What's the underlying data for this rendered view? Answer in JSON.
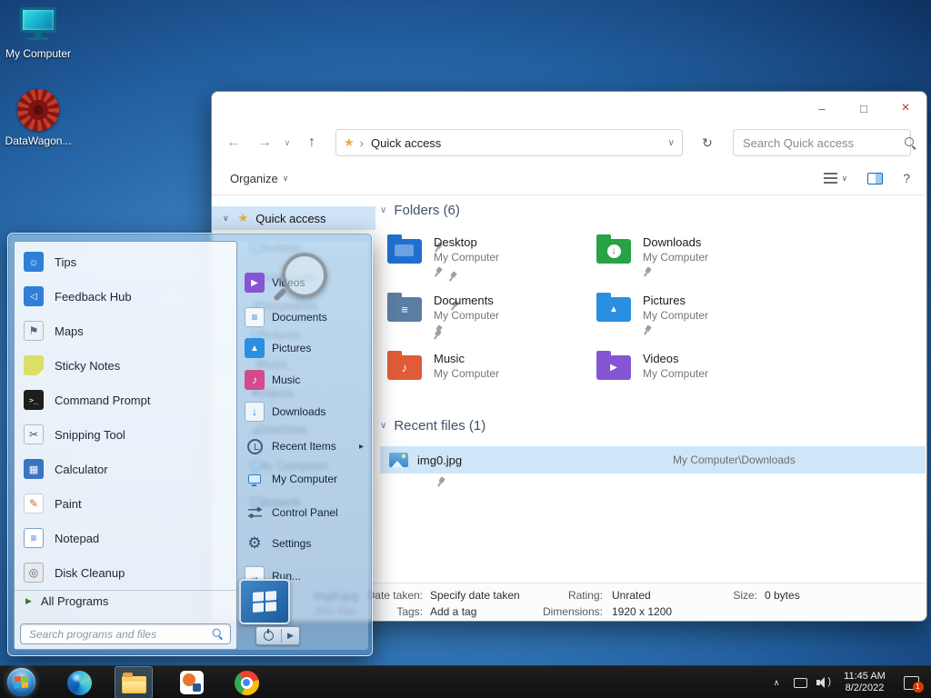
{
  "icons": {
    "minimize": "–",
    "maximize": "□",
    "close": "×",
    "back": "←",
    "forward": "→",
    "up": "↑",
    "refresh": "↻",
    "chevron_down": "∨",
    "chevron_up": "∧",
    "breadcrumb_sep": "›",
    "star": "★",
    "expand_chevron": "›",
    "submenu_arrow": "▸",
    "all_programs_arrow": "▶",
    "help": "?"
  },
  "desktop": {
    "icons": [
      {
        "label": "My Computer"
      },
      {
        "label": "DataWagon..."
      }
    ]
  },
  "explorer": {
    "address_crumb": "Quick access",
    "search_placeholder": "Search Quick access",
    "organize_label": "Organize",
    "sidebar": {
      "quick_access_label": "Quick access",
      "items": [
        {
          "label": "Desktop",
          "glyph": ""
        },
        {
          "label": "Downloads",
          "glyph": "↓"
        },
        {
          "label": "Documents",
          "glyph": "≡"
        },
        {
          "label": "Pictures",
          "glyph": ""
        },
        {
          "label": "Music",
          "glyph": "♪"
        },
        {
          "label": "Videos",
          "glyph": "▶"
        },
        {
          "label": "OneDrive",
          "glyph": "☁"
        },
        {
          "label": "My Computer",
          "glyph": ""
        },
        {
          "label": "Network",
          "glyph": ""
        }
      ]
    },
    "folders_header": "Folders (6)",
    "folders": [
      {
        "name": "Desktop",
        "location": "My Computer",
        "glyph": ""
      },
      {
        "name": "Downloads",
        "location": "My Computer",
        "glyph": "↓"
      },
      {
        "name": "Documents",
        "location": "My Computer",
        "glyph": "≡"
      },
      {
        "name": "Pictures",
        "location": "My Computer",
        "glyph": "▲"
      },
      {
        "name": "Music",
        "location": "My Computer",
        "glyph": "♪"
      },
      {
        "name": "Videos",
        "location": "My Computer",
        "glyph": "▶"
      }
    ],
    "recent_header": "Recent files (1)",
    "recent_file": {
      "name": "img0.jpg",
      "path": "My Computer\\Downloads"
    },
    "details": {
      "file_name": "img0.jpg",
      "file_type": "JPG File",
      "date_taken_label": "Date taken:",
      "date_taken_value": "Specify date taken",
      "tags_label": "Tags:",
      "tags_value": "Add a tag",
      "rating_label": "Rating:",
      "rating_value": "Unrated",
      "dimensions_label": "Dimensions:",
      "dimensions_value": "1920 x 1200",
      "size_label": "Size:",
      "size_value": "0 bytes"
    }
  },
  "start_menu": {
    "left_items": [
      {
        "label": "Tips",
        "glyph": "☼"
      },
      {
        "label": "Feedback Hub",
        "glyph": "◁"
      },
      {
        "label": "Maps",
        "glyph": "⚑"
      },
      {
        "label": "Sticky Notes",
        "glyph": ""
      },
      {
        "label": "Command Prompt",
        "glyph": ">_"
      },
      {
        "label": "Snipping Tool",
        "glyph": "✂"
      },
      {
        "label": "Calculator",
        "glyph": "▦"
      },
      {
        "label": "Paint",
        "glyph": "✎"
      },
      {
        "label": "Notepad",
        "glyph": "≡"
      },
      {
        "label": "Disk Cleanup",
        "glyph": "◎"
      }
    ],
    "all_programs_label": "All Programs",
    "search_placeholder": "Search programs and files",
    "right_items": [
      {
        "label": "Videos",
        "glyph": "▶"
      },
      {
        "label": "Documents",
        "glyph": "≡"
      },
      {
        "label": "Pictures",
        "glyph": "▲"
      },
      {
        "label": "Music",
        "glyph": "♪"
      },
      {
        "label": "Downloads",
        "glyph": "↓"
      },
      {
        "label": "Recent Items",
        "glyph": ""
      },
      {
        "label": "My Computer",
        "glyph": ""
      },
      {
        "label": "Control Panel",
        "glyph": ""
      },
      {
        "label": "Settings",
        "glyph": "⚙"
      },
      {
        "label": "Run...",
        "glyph": "→"
      }
    ]
  },
  "taskbar": {
    "clock_time": "11:45 AM",
    "clock_date": "8/2/2022",
    "notification_badge": "1"
  }
}
